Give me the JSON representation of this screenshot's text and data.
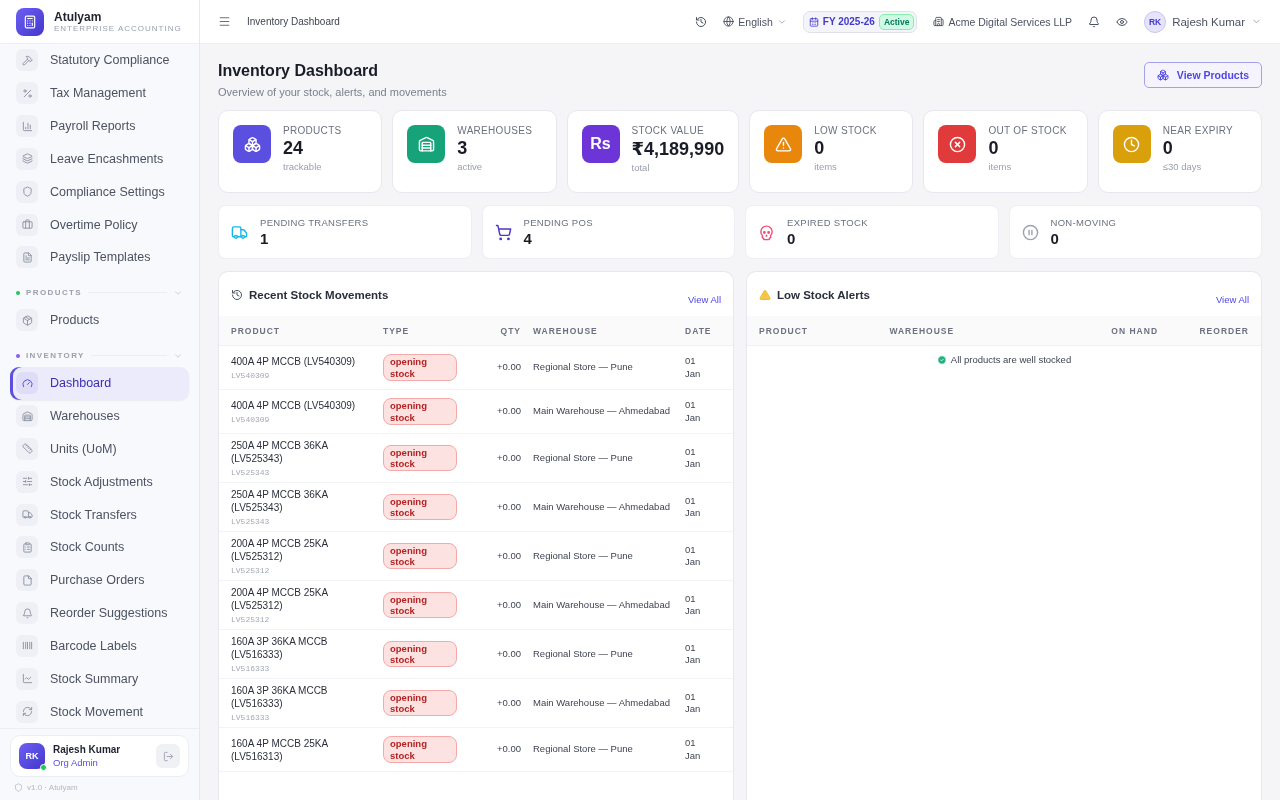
{
  "brand": {
    "name": "Atulyam",
    "tagline": "ENTERPRISE ACCOUNTING"
  },
  "sidebar": {
    "sections": [
      {
        "items": [
          {
            "label": "Statutory Compliance",
            "selected": false
          },
          {
            "label": "Tax Management",
            "selected": false
          },
          {
            "label": "Payroll Reports",
            "selected": false
          },
          {
            "label": "Leave Encashments",
            "selected": false
          },
          {
            "label": "Compliance Settings",
            "selected": false
          },
          {
            "label": "Overtime Policy",
            "selected": false
          },
          {
            "label": "Payslip Templates",
            "selected": false
          }
        ]
      },
      {
        "heading": "PRODUCTS",
        "color": "#22c55e",
        "items": [
          {
            "label": "Products",
            "selected": false
          }
        ]
      },
      {
        "heading": "INVENTORY",
        "color": "#8b5cf6",
        "items": [
          {
            "label": "Dashboard",
            "selected": true
          },
          {
            "label": "Warehouses",
            "selected": false
          },
          {
            "label": "Units (UoM)",
            "selected": false
          },
          {
            "label": "Stock Adjustments",
            "selected": false
          },
          {
            "label": "Stock Transfers",
            "selected": false
          },
          {
            "label": "Stock Counts",
            "selected": false
          },
          {
            "label": "Purchase Orders",
            "selected": false
          },
          {
            "label": "Reorder Suggestions",
            "selected": false
          },
          {
            "label": "Barcode Labels",
            "selected": false
          },
          {
            "label": "Stock Summary",
            "selected": false
          },
          {
            "label": "Stock Movement",
            "selected": false
          }
        ]
      }
    ],
    "user": {
      "initials": "RK",
      "name": "Rajesh Kumar",
      "role": "Org Admin",
      "online": true
    },
    "version": "v1.0 · Atulyam"
  },
  "topbar": {
    "breadcrumb": "Inventory Dashboard",
    "language": "English",
    "fiscal_year": "FY 2025-26",
    "fy_status": "Active",
    "company": "Acme Digital Services LLP",
    "user_initials": "RK",
    "user_name": "Rajesh Kumar"
  },
  "page": {
    "title": "Inventory Dashboard",
    "subtitle": "Overview of your stock, alerts, and movements",
    "action": "View Products"
  },
  "stats": [
    {
      "label": "PRODUCTS",
      "value": "24",
      "note": "trackable",
      "color": "#5b4fe0"
    },
    {
      "label": "WAREHOUSES",
      "value": "3",
      "note": "active",
      "color": "#16a37a"
    },
    {
      "label": "STOCK VALUE",
      "value": "₹4,189,990",
      "note": "total",
      "color": "#6d35d8",
      "symbol": "Rs"
    },
    {
      "label": "LOW STOCK",
      "value": "0",
      "note": "items",
      "color": "#e8870b"
    },
    {
      "label": "OUT OF STOCK",
      "value": "0",
      "note": "items",
      "color": "#e03a3a"
    },
    {
      "label": "NEAR EXPIRY",
      "value": "0",
      "note": "≤30 days",
      "color": "#d9a00c"
    }
  ],
  "secondary_stats": [
    {
      "label": "PENDING TRANSFERS",
      "value": "1",
      "color": "#14b8e6"
    },
    {
      "label": "PENDING POS",
      "value": "4",
      "color": "#4f35c8"
    },
    {
      "label": "EXPIRED STOCK",
      "value": "0",
      "color": "#f0507a"
    },
    {
      "label": "NON-MOVING",
      "value": "0",
      "color": "#9ca3af"
    }
  ],
  "movements": {
    "title": "Recent Stock Movements",
    "link": "View All",
    "columns": [
      "PRODUCT",
      "TYPE",
      "QTY",
      "WAREHOUSE",
      "DATE"
    ],
    "rows": [
      {
        "product": "400A 4P MCCB (LV540309)",
        "sku": "LV540309",
        "type": "opening stock",
        "qty": "+0.00",
        "warehouse": "Regional Store — Pune",
        "date": "01 Jan"
      },
      {
        "product": "400A 4P MCCB (LV540309)",
        "sku": "LV540309",
        "type": "opening stock",
        "qty": "+0.00",
        "warehouse": "Main Warehouse — Ahmedabad",
        "date": "01 Jan"
      },
      {
        "product": "250A 4P MCCB 36KA (LV525343)",
        "sku": "LV525343",
        "type": "opening stock",
        "qty": "+0.00",
        "warehouse": "Regional Store — Pune",
        "date": "01 Jan"
      },
      {
        "product": "250A 4P MCCB 36KA (LV525343)",
        "sku": "LV525343",
        "type": "opening stock",
        "qty": "+0.00",
        "warehouse": "Main Warehouse — Ahmedabad",
        "date": "01 Jan"
      },
      {
        "product": "200A 4P MCCB 25KA (LV525312)",
        "sku": "LV525312",
        "type": "opening stock",
        "qty": "+0.00",
        "warehouse": "Regional Store — Pune",
        "date": "01 Jan"
      },
      {
        "product": "200A 4P MCCB 25KA (LV525312)",
        "sku": "LV525312",
        "type": "opening stock",
        "qty": "+0.00",
        "warehouse": "Main Warehouse — Ahmedabad",
        "date": "01 Jan"
      },
      {
        "product": "160A 3P 36KA MCCB (LV516333)",
        "sku": "LV516333",
        "type": "opening stock",
        "qty": "+0.00",
        "warehouse": "Regional Store — Pune",
        "date": "01 Jan"
      },
      {
        "product": "160A 3P 36KA MCCB (LV516333)",
        "sku": "LV516333",
        "type": "opening stock",
        "qty": "+0.00",
        "warehouse": "Main Warehouse — Ahmedabad",
        "date": "01 Jan"
      },
      {
        "product": "160A 4P MCCB 25KA (LV516313)",
        "type": "opening stock",
        "qty": "+0.00",
        "warehouse": "Regional Store — Pune",
        "date": "01 Jan"
      }
    ]
  },
  "alerts": {
    "title": "Low Stock Alerts",
    "link": "View All",
    "columns": [
      "PRODUCT",
      "WAREHOUSE",
      "ON HAND",
      "REORDER"
    ],
    "empty": "All products are well stocked"
  }
}
